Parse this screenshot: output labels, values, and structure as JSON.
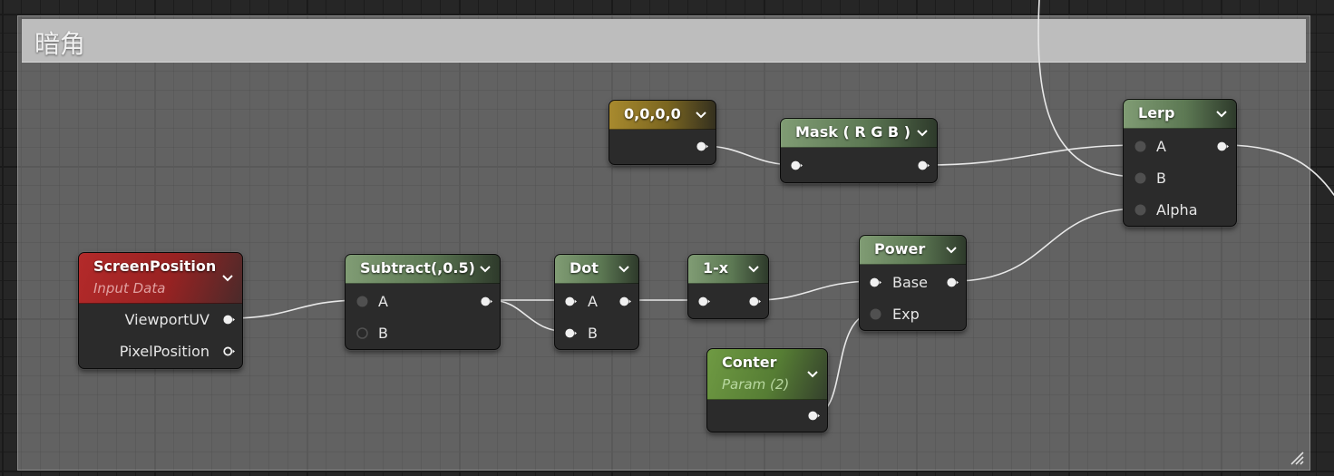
{
  "comment": {
    "title": "暗角"
  },
  "nodes": {
    "screen_position": {
      "title": "ScreenPosition",
      "subtitle": "Input Data",
      "outputs": [
        "ViewportUV",
        "PixelPosition"
      ]
    },
    "constant": {
      "title": "0,0,0,0"
    },
    "mask": {
      "title": "Mask ( R G B )"
    },
    "lerp": {
      "title": "Lerp",
      "inputs": [
        "A",
        "B",
        "Alpha"
      ]
    },
    "subtract": {
      "title": "Subtract(,0.5)",
      "inputs": [
        "A",
        "B"
      ]
    },
    "dot": {
      "title": "Dot",
      "inputs": [
        "A",
        "B"
      ]
    },
    "one_minus": {
      "title": "1-x"
    },
    "power": {
      "title": "Power",
      "inputs": [
        "Base",
        "Exp"
      ]
    },
    "conter": {
      "title": "Conter",
      "subtitle": "Param (2)"
    }
  },
  "colors": {
    "material_node_header": "#6e8c64",
    "constant_node_header": "#a88a2e",
    "input_data_header": "#b42a2a",
    "parameter_header": "#6f9a43",
    "wire": "#e8e8e8"
  }
}
